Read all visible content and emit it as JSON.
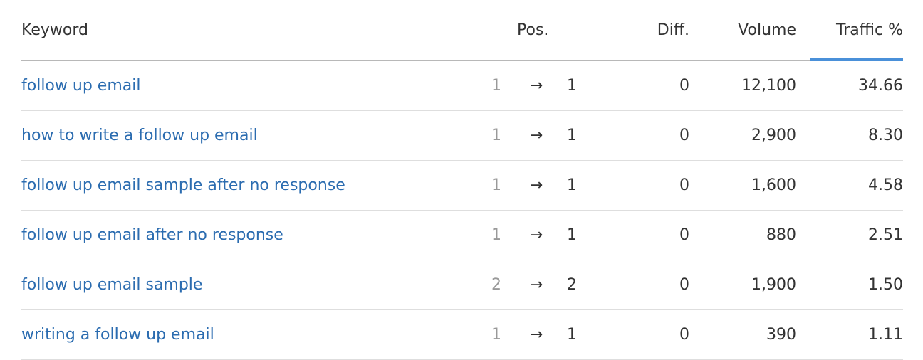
{
  "header": {
    "keyword": "Keyword",
    "pos": "Pos.",
    "diff": "Diff.",
    "volume": "Volume",
    "traffic": "Traffic %"
  },
  "colors": {
    "link": "#2b6cb0",
    "sort_accent": "#4a90d9"
  },
  "rows": [
    {
      "keyword": "follow up email",
      "prev_pos": "1",
      "arrow": "→",
      "pos": "1",
      "diff": "0",
      "volume": "12,100",
      "traffic": "34.66"
    },
    {
      "keyword": "how to write a follow up email",
      "prev_pos": "1",
      "arrow": "→",
      "pos": "1",
      "diff": "0",
      "volume": "2,900",
      "traffic": "8.30"
    },
    {
      "keyword": "follow up email sample after no response",
      "prev_pos": "1",
      "arrow": "→",
      "pos": "1",
      "diff": "0",
      "volume": "1,600",
      "traffic": "4.58"
    },
    {
      "keyword": "follow up email after no response",
      "prev_pos": "1",
      "arrow": "→",
      "pos": "1",
      "diff": "0",
      "volume": "880",
      "traffic": "2.51"
    },
    {
      "keyword": "follow up email sample",
      "prev_pos": "2",
      "arrow": "→",
      "pos": "2",
      "diff": "0",
      "volume": "1,900",
      "traffic": "1.50"
    },
    {
      "keyword": "writing a follow up email",
      "prev_pos": "1",
      "arrow": "→",
      "pos": "1",
      "diff": "0",
      "volume": "390",
      "traffic": "1.11"
    }
  ]
}
